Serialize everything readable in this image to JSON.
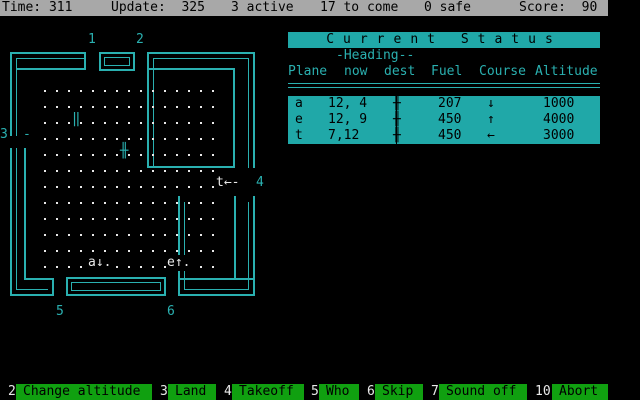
{
  "topbar": {
    "time": "Time: 311",
    "update": "Update:  325",
    "active": "3 active",
    "to_come": "17 to come",
    "safe": "0 safe",
    "score": "Score:  90"
  },
  "radar": {
    "exits": {
      "e1": "1",
      "e2": "2",
      "e3": "3",
      "e4": "4",
      "e5": "5",
      "e6": "6"
    },
    "exit3_mark": "-",
    "plane_t": "t←-",
    "plane_a": "a↓.",
    "plane_e": "e↑.",
    "runway_a": "‖",
    "runway_b": "╫"
  },
  "status": {
    "title": "Current Status",
    "heading_label": "-Heading--",
    "columns": [
      "Plane",
      "now",
      "dest",
      "Fuel",
      "Course",
      "Altitude"
    ],
    "rows": [
      {
        "plane": "a",
        "now": "12, 4",
        "dest": "╫",
        "fuel": "207",
        "course": "↓",
        "altitude": "1000"
      },
      {
        "plane": "e",
        "now": "12, 9",
        "dest": "╫",
        "fuel": "450",
        "course": "↑",
        "altitude": "4000"
      },
      {
        "plane": "t",
        "now": "7,12",
        "dest": "╫",
        "fuel": "450",
        "course": "←",
        "altitude": "3000"
      }
    ]
  },
  "fkeys": [
    {
      "num": "2",
      "label": "Change altitude"
    },
    {
      "num": "3",
      "label": "Land"
    },
    {
      "num": "4",
      "label": "Takeoff"
    },
    {
      "num": "5",
      "label": "Who"
    },
    {
      "num": "6",
      "label": "Skip"
    },
    {
      "num": "7",
      "label": "Sound off"
    },
    {
      "num": "10",
      "label": "Abort"
    }
  ],
  "colors": {
    "cyan": "#20a8a8",
    "green": "#10a010",
    "grey": "#a8a8a8"
  }
}
